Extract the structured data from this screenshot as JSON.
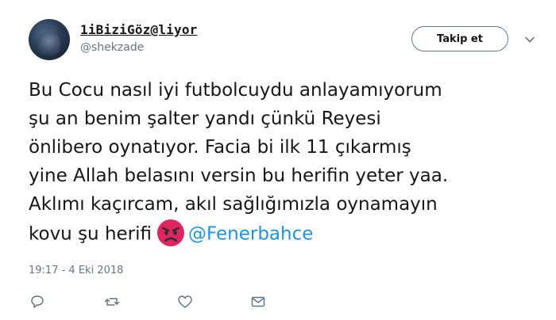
{
  "user": {
    "display_name": "1iBiziGöz@liyor",
    "username": "@shekzade"
  },
  "follow_button": {
    "label": "Takip et"
  },
  "tweet": {
    "lines": [
      "Bu Cocu nasıl iyi futbolcuydu anlayamıyorum",
      "şu an benim şalter yandı çünkü Reyesi",
      "önlibero oynatıyor. Facia bi ilk 11 çıkarmış",
      "yine Allah belasını versin bu herifin yeter yaa.",
      "Aklımı kaçırcam, akıl sağlığımızla oynamayın",
      "kovu şu herifi"
    ],
    "mention": "@Fenerbahce",
    "timestamp": "19:17 - 4 Eki 2018"
  },
  "icons": {
    "caret": "chevron-down-icon",
    "reply": "reply-icon",
    "retweet": "retweet-icon",
    "like": "heart-icon",
    "dm": "envelope-icon",
    "emoji": "angry-face-icon"
  },
  "colors": {
    "text": "#14171a",
    "secondary": "#657786",
    "link": "#1b95e0",
    "emoji_red": "#e0245e"
  }
}
